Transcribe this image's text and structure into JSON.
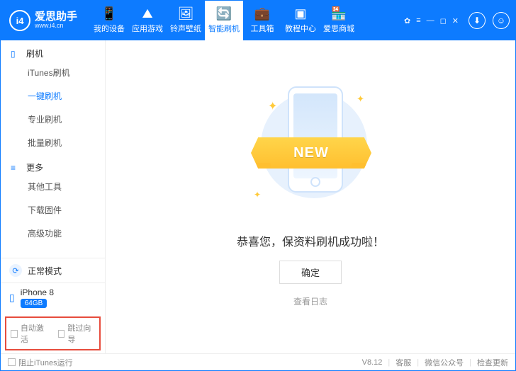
{
  "header": {
    "logo_title": "爱思助手",
    "logo_sub": "www.i4.cn",
    "tabs": [
      {
        "label": "我的设备",
        "icon": "📱"
      },
      {
        "label": "应用游戏",
        "icon": "⛰"
      },
      {
        "label": "铃声壁纸",
        "icon": "🖼"
      },
      {
        "label": "智能刷机",
        "icon": "🔄"
      },
      {
        "label": "工具箱",
        "icon": "💼"
      },
      {
        "label": "教程中心",
        "icon": "▣"
      },
      {
        "label": "爱思商城",
        "icon": "🏪"
      }
    ],
    "active_tab": 3
  },
  "sidebar": {
    "group1": {
      "label": "刷机"
    },
    "items1": [
      {
        "label": "iTunes刷机"
      },
      {
        "label": "一键刷机"
      },
      {
        "label": "专业刷机"
      },
      {
        "label": "批量刷机"
      }
    ],
    "active_item1": 1,
    "group2": {
      "label": "更多"
    },
    "items2": [
      {
        "label": "其他工具"
      },
      {
        "label": "下载固件"
      },
      {
        "label": "高级功能"
      }
    ],
    "mode_label": "正常模式",
    "device": {
      "name": "iPhone 8",
      "storage": "64GB"
    },
    "checks": {
      "auto_activate": "自动激活",
      "skip_guide": "跳过向导"
    }
  },
  "main": {
    "ribbon_text": "NEW",
    "success_msg": "恭喜您，保资料刷机成功啦！",
    "ok_label": "确定",
    "log_label": "查看日志"
  },
  "footer": {
    "block_itunes": "阻止iTunes运行",
    "version": "V8.12",
    "support": "客服",
    "wechat": "微信公众号",
    "update": "检查更新"
  }
}
